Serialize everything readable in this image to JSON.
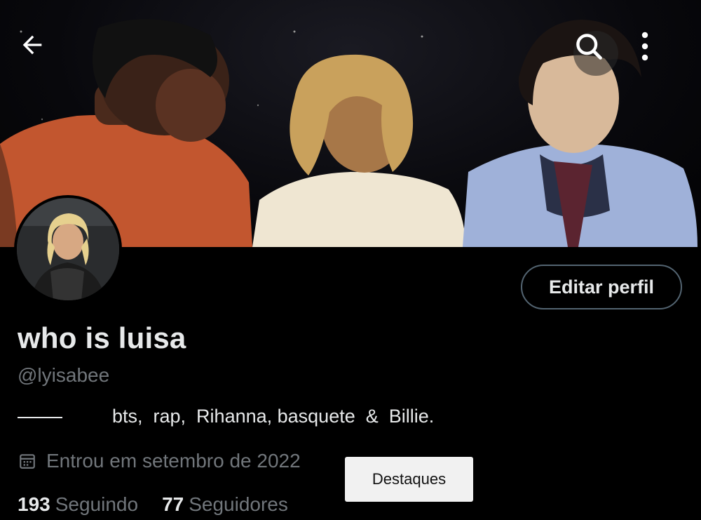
{
  "profile": {
    "display_name": "who is luisa",
    "handle": "@lyisabee",
    "bio": "bts,  rap,  Rihanna, basquete  &  Billie.",
    "joined": "Entrou em setembro de 2022"
  },
  "actions": {
    "edit_profile_label": "Editar perfil"
  },
  "follows": {
    "following_count": "193",
    "following_label": "Seguindo",
    "followers_count": "77",
    "followers_label": "Seguidores"
  },
  "popup": {
    "highlights_label": "Destaques"
  },
  "icons": {
    "back": "arrow-left-icon",
    "search": "search-icon",
    "more": "more-vertical-icon",
    "calendar": "calendar-icon"
  },
  "colors": {
    "background": "#000000",
    "primary_text": "#e7e9ea",
    "secondary_text": "#71767b",
    "button_border": "#536471"
  }
}
